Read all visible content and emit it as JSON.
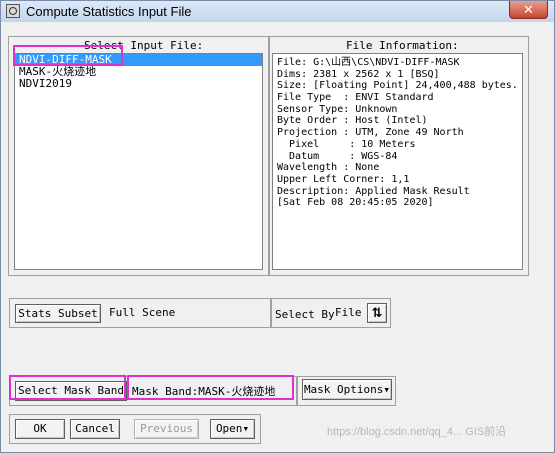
{
  "window": {
    "title": "Compute Statistics Input File",
    "close_glyph": "✕"
  },
  "select_input": {
    "title": "Select Input File:",
    "files": [
      "NDVI-DIFF-MASK",
      "MASK-火烧迹地",
      "NDVI2019"
    ],
    "selected_index": 0
  },
  "file_info": {
    "title": "File Information:",
    "lines": [
      "File: G:\\山西\\CS\\NDVI-DIFF-MASK",
      "Dims: 2381 x 2562 x 1 [BSQ]",
      "Size: [Floating Point] 24,400,488 bytes.",
      "File Type  : ENVI Standard",
      "Sensor Type: Unknown",
      "Byte Order : Host (Intel)",
      "Projection : UTM, Zone 49 North",
      "  Pixel     : 10 Meters",
      "  Datum     : WGS-84",
      "Wavelength : None",
      "Upper Left Corner: 1,1",
      "Description: Applied Mask Result",
      "[Sat Feb 08 20:45:05 2020]"
    ]
  },
  "stats_subset": {
    "button": "Stats Subset",
    "value": "Full Scene"
  },
  "select_by": {
    "label": "Select By",
    "value": "File",
    "toggle_glyph": "⇅"
  },
  "mask": {
    "button": "Select Mask Band",
    "label": "Mask Band:MASK-火烧迹地",
    "options": "Mask Options",
    "options_arrow": "▾"
  },
  "bottom": {
    "ok": "OK",
    "cancel": "Cancel",
    "previous": "Previous",
    "open": "Open",
    "open_arrow": "▾"
  },
  "watermark": "https://blog.csdn.net/qq_4... GIS前沿",
  "accent_colors": {
    "selection": "#3399ff",
    "highlight": "#e030d0"
  }
}
